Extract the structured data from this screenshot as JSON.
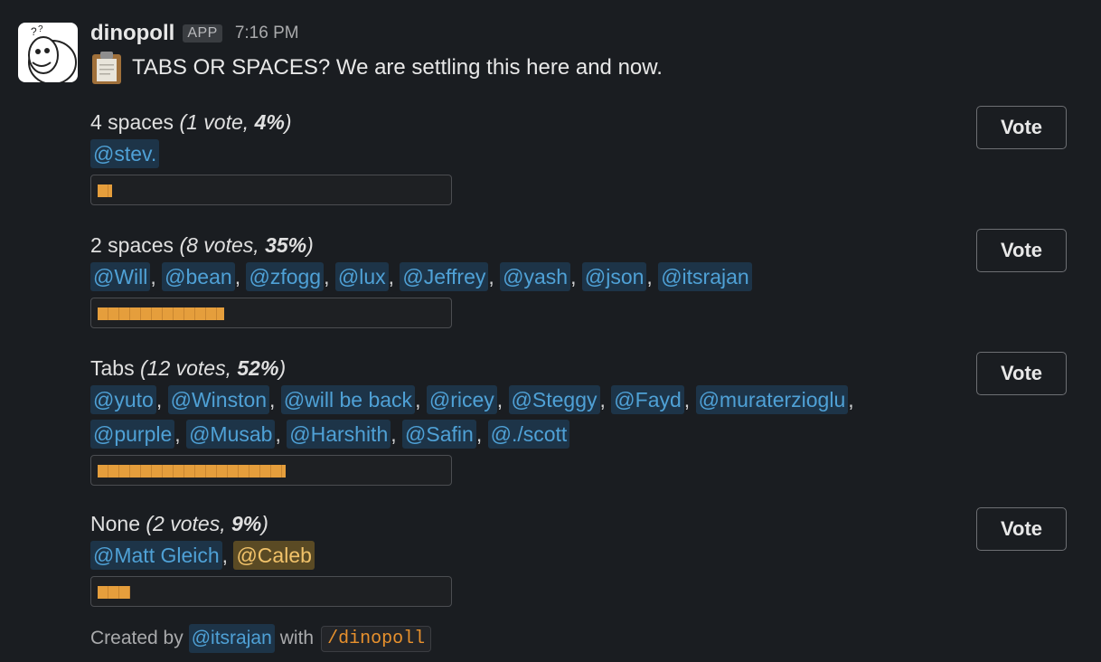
{
  "message": {
    "username": "dinopoll",
    "badge": "APP",
    "time": "7:16 PM",
    "title": "TABS OR SPACES? We are settling this here and now."
  },
  "options": [
    {
      "label": "4 spaces",
      "votes_text": "1 vote",
      "percent_text": "4%",
      "percent": 4,
      "voters": [
        "@stev."
      ],
      "vote_label": "Vote"
    },
    {
      "label": "2 spaces",
      "votes_text": "8 votes",
      "percent_text": "35%",
      "percent": 35,
      "voters": [
        "@Will",
        "@bean",
        "@zfogg",
        "@lux",
        "@Jeffrey",
        "@yash",
        "@json",
        "@itsrajan"
      ],
      "vote_label": "Vote"
    },
    {
      "label": "Tabs",
      "votes_text": "12 votes",
      "percent_text": "52%",
      "percent": 52,
      "voters": [
        "@yuto",
        "@Winston",
        "@will be back",
        "@ricey",
        "@Steggy",
        "@Fayd",
        "@muraterzioglu",
        "@purple",
        "@Musab",
        "@Harshith",
        "@Safin",
        "@./scott"
      ],
      "vote_label": "Vote"
    },
    {
      "label": "None",
      "votes_text": "2 votes",
      "percent_text": "9%",
      "percent": 9,
      "voters": [
        "@Matt Gleich",
        "@Caleb"
      ],
      "vote_label": "Vote"
    }
  ],
  "footer": {
    "prefix": "Created by",
    "creator": "@itsrajan",
    "middle": "with",
    "command": "/dinopoll"
  },
  "colors": {
    "background": "#1a1d21",
    "mention": "#4fa1d6",
    "mention_bg": "#1d3448",
    "self_mention": "#f1c26a",
    "bar_fill": "#e59e3c"
  },
  "icons": {
    "avatar": "dinosaur-avatar-icon",
    "title": "clipboard-icon"
  }
}
